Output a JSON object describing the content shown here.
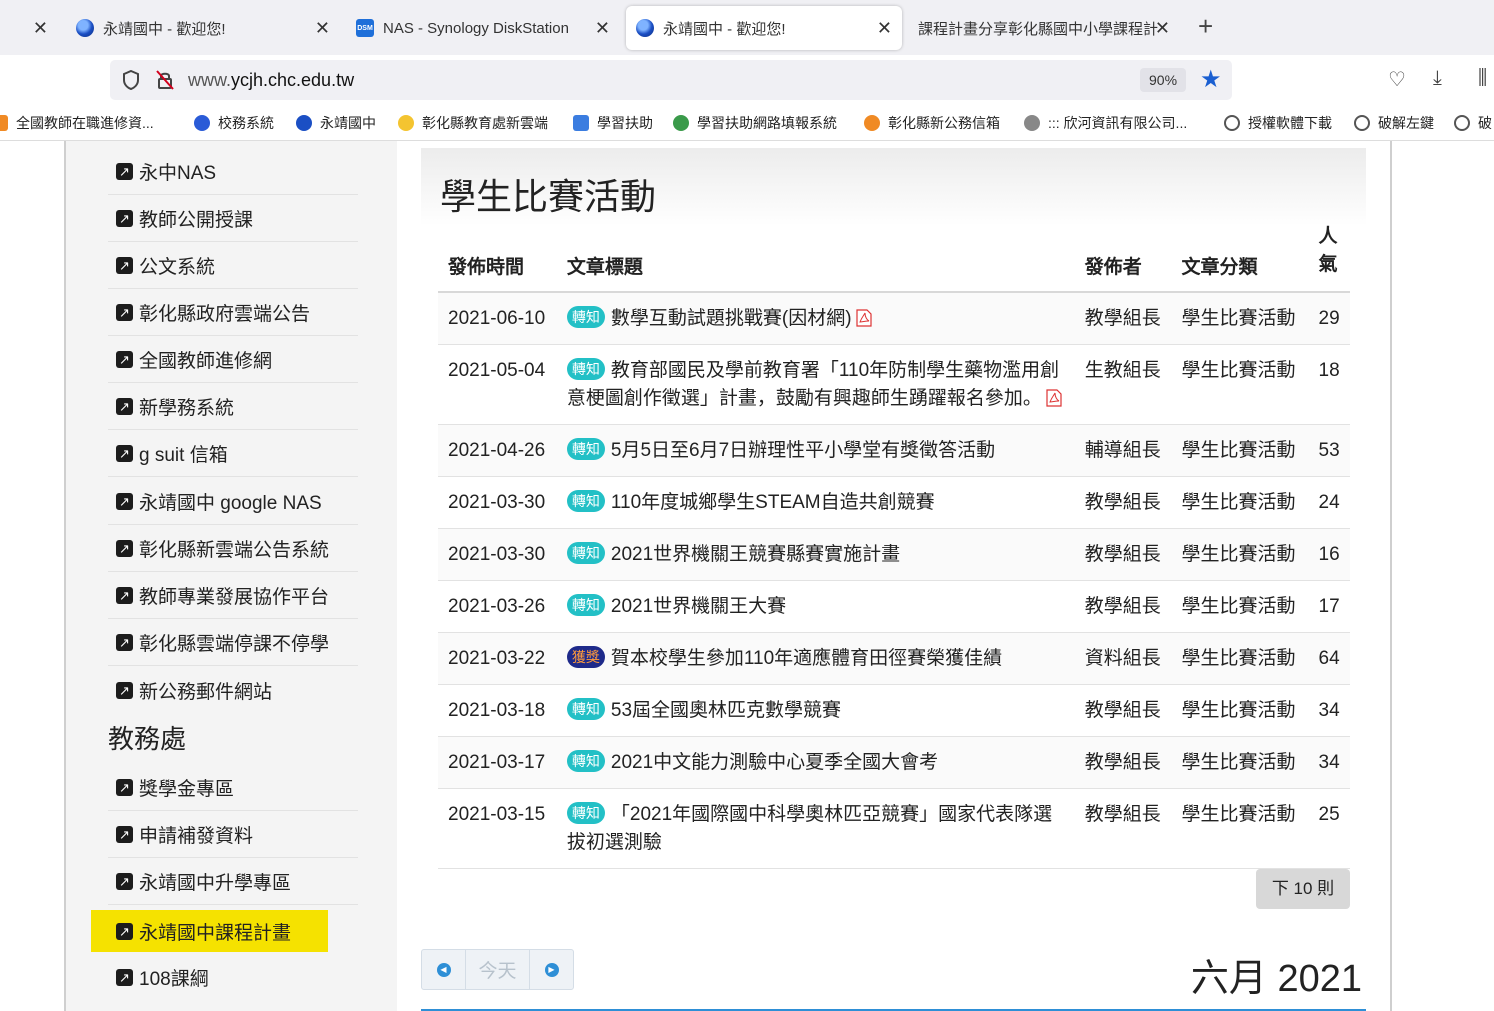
{
  "browser": {
    "tabs": [
      {
        "title": "",
        "active": false
      },
      {
        "title": "永靖國中 - 歡迎您!",
        "active": false,
        "icon": "school-globe-icon"
      },
      {
        "title": "NAS - Synology DiskStation",
        "active": false,
        "icon": "dsm-icon",
        "icon_text": "DSM"
      },
      {
        "title": "永靖國中 - 歡迎您!",
        "active": true,
        "icon": "school-globe-icon"
      },
      {
        "title": "課程計畫分享彰化縣國中小學課程計",
        "active": false
      }
    ],
    "url_prefix": "www.",
    "url_domain": "ycjh.chc.edu.tw",
    "zoom": "90%",
    "bookmarks": [
      "全國教師在職進修資...",
      "校務系統",
      "永靖國中",
      "彰化縣教育處新雲端",
      "學習扶助",
      "學習扶助網路填報系統",
      "彰化縣新公務信箱",
      "::: 欣河資訊有限公司...",
      "授權軟體下載",
      "破解左鍵",
      "破"
    ]
  },
  "sidebar": {
    "items_top": [
      "永中NAS",
      "教師公開授課",
      "公文系統",
      "彰化縣政府雲端公告",
      "全國教師進修網",
      "新學務系統",
      "g suit 信箱",
      "永靖國中 google NAS",
      "彰化縣新雲端公告系統",
      "教師專業發展協作平台",
      "彰化縣雲端停課不停學",
      "新公務郵件網站"
    ],
    "heading": "教務處",
    "items_bottom": [
      "獎學金專區",
      "申請補發資料",
      "永靖國中升學專區",
      "永靖國中課程計畫",
      "108課綱"
    ],
    "highlight_color": "#f5e200"
  },
  "main": {
    "title": "學生比賽活動",
    "headers": {
      "date": "發佈時間",
      "title": "文章標題",
      "author": "發佈者",
      "category": "文章分類",
      "popularity": "人氣"
    },
    "rows": [
      {
        "date": "2021-06-10",
        "badge": "轉知",
        "title": "數學互動試題挑戰賽(因材網)",
        "pdf": true,
        "author": "教學組長",
        "category": "學生比賽活動",
        "views": "29"
      },
      {
        "date": "2021-05-04",
        "badge": "轉知",
        "title": "教育部國民及學前教育署「110年防制學生藥物濫用創意梗圖創作徵選」計畫，鼓勵有興趣師生踴躍報名參加。",
        "pdf": true,
        "author": "生教組長",
        "category": "學生比賽活動",
        "views": "18"
      },
      {
        "date": "2021-04-26",
        "badge": "轉知",
        "title": "5月5日至6月7日辦理性平小學堂有獎徵答活動",
        "pdf": false,
        "author": "輔導組長",
        "category": "學生比賽活動",
        "views": "53"
      },
      {
        "date": "2021-03-30",
        "badge": "轉知",
        "title": "110年度城鄉學生STEAM自造共創競賽",
        "pdf": false,
        "author": "教學組長",
        "category": "學生比賽活動",
        "views": "24"
      },
      {
        "date": "2021-03-30",
        "badge": "轉知",
        "title": "2021世界機關王競賽縣賽實施計畫",
        "pdf": false,
        "author": "教學組長",
        "category": "學生比賽活動",
        "views": "16"
      },
      {
        "date": "2021-03-26",
        "badge": "轉知",
        "title": "2021世界機關王大賽",
        "pdf": false,
        "author": "教學組長",
        "category": "學生比賽活動",
        "views": "17"
      },
      {
        "date": "2021-03-22",
        "badge": "獲獎",
        "award": true,
        "title": "賀本校學生參加110年適應體育田徑賽榮獲佳績",
        "pdf": false,
        "author": "資料組長",
        "category": "學生比賽活動",
        "views": "64"
      },
      {
        "date": "2021-03-18",
        "badge": "轉知",
        "title": "53屆全國奧林匹克數學競賽",
        "pdf": false,
        "author": "教學組長",
        "category": "學生比賽活動",
        "views": "34"
      },
      {
        "date": "2021-03-17",
        "badge": "轉知",
        "title": "2021中文能力測驗中心夏季全國大會考",
        "pdf": false,
        "author": "教學組長",
        "category": "學生比賽活動",
        "views": "34"
      },
      {
        "date": "2021-03-15",
        "badge": "轉知",
        "title": "「2021年國際國中科學奧林匹亞競賽」國家代表隊選拔初選測驗",
        "pdf": false,
        "author": "教學組長",
        "category": "學生比賽活動",
        "views": "25"
      }
    ],
    "next_button": "下 10 則",
    "calendar": {
      "today": "今天",
      "month_label": "六月",
      "year": "2021"
    }
  }
}
